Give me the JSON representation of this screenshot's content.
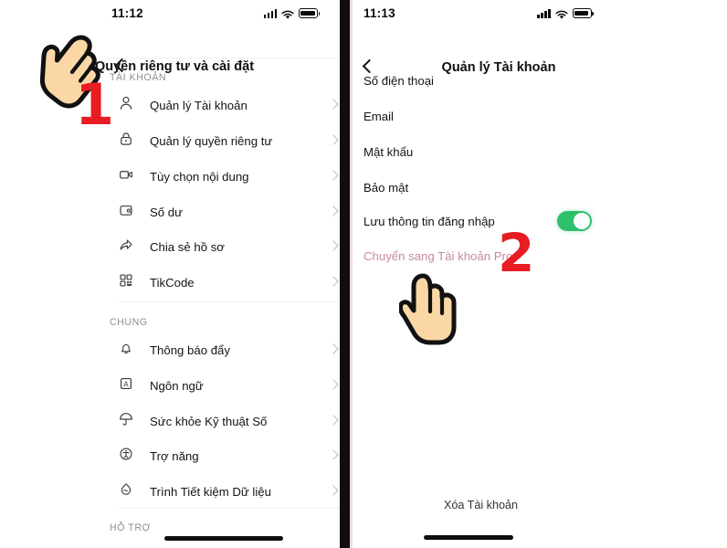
{
  "left_phone": {
    "status": {
      "time": "11:12",
      "signal_icon": "cellular-bars-icon",
      "wifi_icon": "wifi-icon",
      "battery_icon": "battery-full-icon"
    },
    "nav": {
      "back_icon": "back-chevron-icon",
      "title": "Quyền riêng tư và cài đặt"
    },
    "sections": [
      {
        "header": "TÀI KHOẢN",
        "items": [
          {
            "icon": "person-icon",
            "label": "Quản lý Tài khoản",
            "chevron": "chevron-right-icon"
          },
          {
            "icon": "lock-icon",
            "label": "Quản lý quyền riêng tư",
            "chevron": "chevron-right-icon"
          },
          {
            "icon": "video-box-icon",
            "label": "Tùy chọn nội dung",
            "chevron": "chevron-right-icon"
          },
          {
            "icon": "wallet-icon",
            "label": "Số dư",
            "chevron": "chevron-right-icon"
          },
          {
            "icon": "share-arrow-icon",
            "label": "Chia sẻ hồ sơ",
            "chevron": "chevron-right-icon"
          },
          {
            "icon": "qr-code-icon",
            "label": "TikCode",
            "chevron": "chevron-right-icon"
          }
        ]
      },
      {
        "header": "CHUNG",
        "items": [
          {
            "icon": "bell-icon",
            "label": "Thông báo đẩy",
            "chevron": "chevron-right-icon"
          },
          {
            "icon": "language-a-icon",
            "label": "Ngôn ngữ",
            "chevron": "chevron-right-icon"
          },
          {
            "icon": "umbrella-icon",
            "label": "Sức khỏe Kỹ thuật Số",
            "chevron": "chevron-right-icon"
          },
          {
            "icon": "accessibility-icon",
            "label": "Trợ năng",
            "chevron": "chevron-right-icon"
          },
          {
            "icon": "data-saver-icon",
            "label": "Trình Tiết kiệm Dữ liệu",
            "chevron": "chevron-right-icon"
          }
        ]
      },
      {
        "header": "HỖ TRỢ",
        "items": []
      }
    ]
  },
  "right_phone": {
    "status": {
      "time": "11:13",
      "signal_icon": "cellular-bars-icon",
      "wifi_icon": "wifi-icon",
      "battery_icon": "battery-full-icon"
    },
    "nav": {
      "back_icon": "back-chevron-icon",
      "title": "Quản lý Tài khoản"
    },
    "items": [
      {
        "label": "Số điện thoại",
        "type": "chevron",
        "chevron": "chevron-right-icon"
      },
      {
        "label": "Email",
        "type": "chevron",
        "chevron": "chevron-right-icon"
      },
      {
        "label": "Mật khẩu",
        "type": "chevron",
        "chevron": "chevron-right-icon"
      },
      {
        "label": "Bảo mật",
        "type": "chevron",
        "chevron": "chevron-right-icon"
      },
      {
        "label": "Lưu thông tin đăng nhập",
        "type": "toggle",
        "toggle_on": true
      },
      {
        "label": "Chuyển sang Tài khoản Pro",
        "type": "chevron",
        "chevron": "chevron-right-icon",
        "color": "#c78a9e"
      }
    ],
    "delete_account": "Xóa Tài khoản"
  },
  "annotations": {
    "step_one": "1",
    "step_two": "2",
    "hand_one_icon": "pointing-hand-icon",
    "hand_two_icon": "pointing-hand-icon",
    "accent_color": "#e81c23",
    "toggle_on_color": "#2ec06a",
    "pro_link_color": "#c78a9e"
  }
}
